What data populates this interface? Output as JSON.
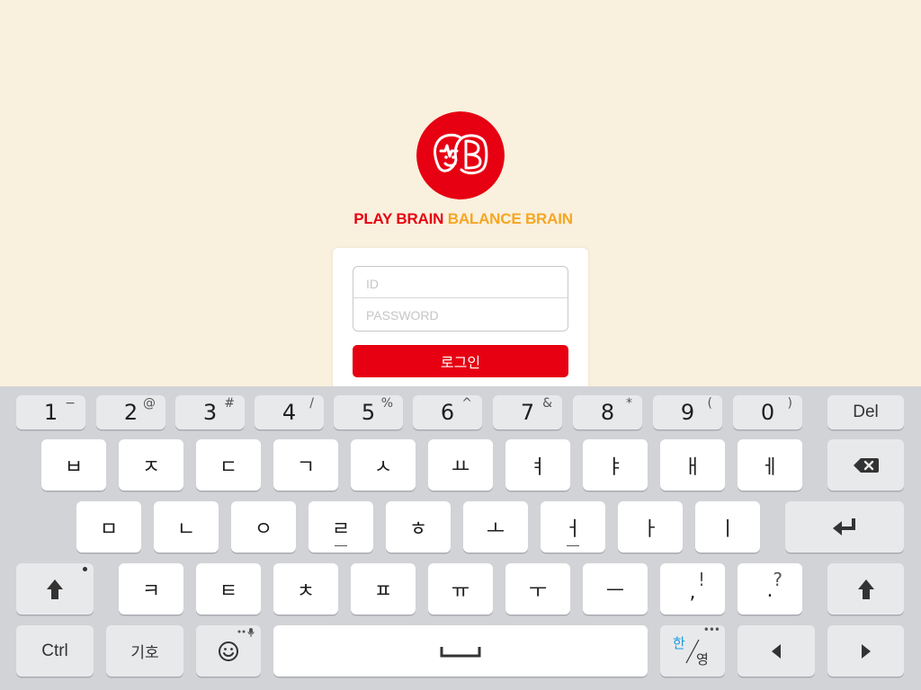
{
  "login": {
    "brand_play": "PLAY BRAIN",
    "brand_balance": "BALANCE BRAIN",
    "id_placeholder": "ID",
    "password_placeholder": "PASSWORD",
    "login_button": "로그인"
  },
  "colors": {
    "brand_red": "#e60012",
    "brand_orange": "#f5a623",
    "background": "#f9f0dd"
  },
  "keyboard": {
    "numbers": [
      {
        "main": "1",
        "sub": "−"
      },
      {
        "main": "2",
        "sub": "@"
      },
      {
        "main": "3",
        "sub": "#"
      },
      {
        "main": "4",
        "sub": "/"
      },
      {
        "main": "5",
        "sub": "%"
      },
      {
        "main": "6",
        "sub": "^"
      },
      {
        "main": "7",
        "sub": "&"
      },
      {
        "main": "8",
        "sub": "*"
      },
      {
        "main": "9",
        "sub": "("
      },
      {
        "main": "0",
        "sub": ")"
      }
    ],
    "del": "Del",
    "row1": [
      "ㅂ",
      "ㅈ",
      "ㄷ",
      "ㄱ",
      "ㅅ",
      "ㅛ",
      "ㅕ",
      "ㅑ",
      "ㅐ",
      "ㅔ"
    ],
    "row2": [
      "ㅁ",
      "ㄴ",
      "ㅇ",
      "ㄹ",
      "ㅎ",
      "ㅗ",
      "ㅓ",
      "ㅏ",
      "ㅣ"
    ],
    "row3": [
      "ㅋ",
      "ㅌ",
      "ㅊ",
      "ㅍ",
      "ㅠ",
      "ㅜ",
      "ㅡ"
    ],
    "comma": {
      "main": ",",
      "sub": "!"
    },
    "period": {
      "main": ".",
      "sub": "?"
    },
    "ctrl": "Ctrl",
    "symbols": "기호",
    "lang_han": "한",
    "lang_yeong": "영",
    "icons": {
      "backspace": "backspace-icon",
      "enter": "enter-icon",
      "shift": "shift-icon",
      "emoji": "emoji-icon",
      "space": "space-bar-icon",
      "left": "arrow-left-icon",
      "right": "arrow-right-icon"
    }
  }
}
